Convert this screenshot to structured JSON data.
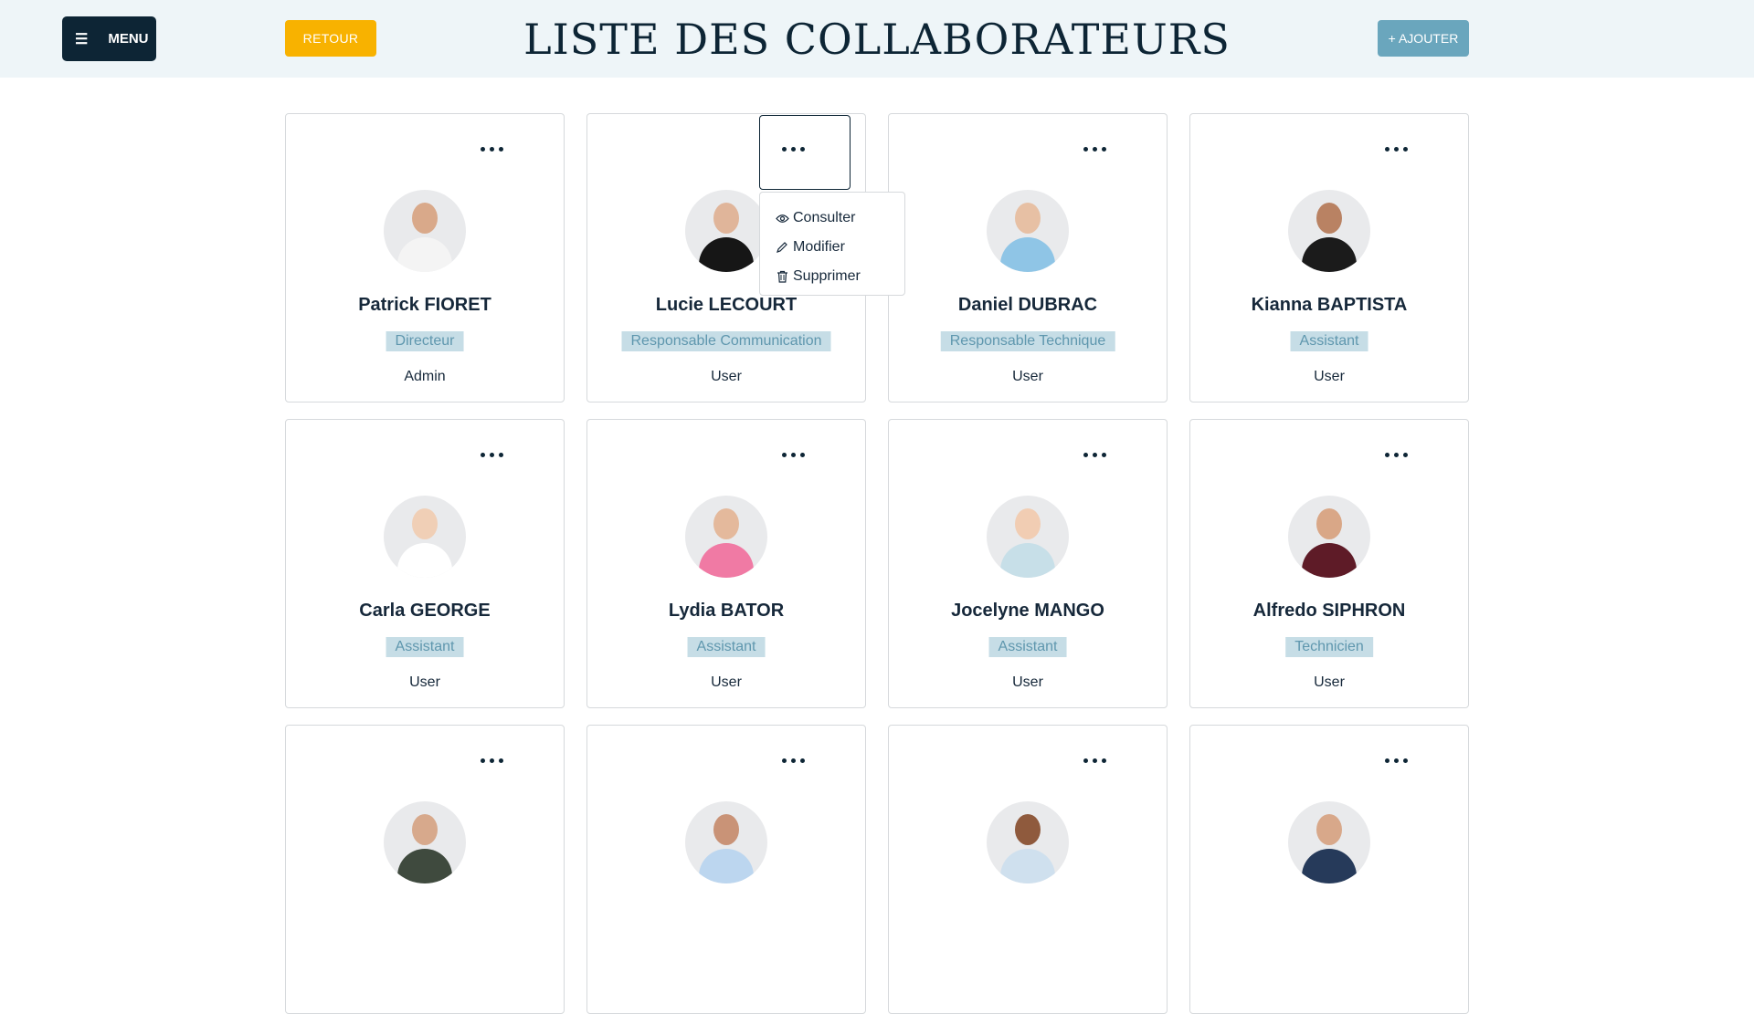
{
  "header": {
    "menu_label": "MENU",
    "back_label": "RETOUR",
    "title": "LISTE DES COLLABORATEURS",
    "add_label": "+ AJOUTER"
  },
  "colors": {
    "header_bg": "#eef5f8",
    "menu_bg": "#0d2535",
    "back_bg": "#f8b200",
    "add_bg": "#6aa6bd",
    "role_bg": "#c6dde6",
    "role_text": "#5f97ae"
  },
  "dropdown": {
    "items": [
      {
        "label": "Consulter",
        "icon": "eye-icon"
      },
      {
        "label": "Modifier",
        "icon": "pencil-icon"
      },
      {
        "label": "Supprimer",
        "icon": "trash-icon"
      }
    ]
  },
  "collaborators": [
    {
      "name": "Patrick FIORET",
      "role": "Directeur",
      "account": "Admin",
      "skin": "#d9a98a",
      "shirt": "#f4f4f4"
    },
    {
      "name": "Lucie LECOURT",
      "role": "Responsable Communication",
      "account": "User",
      "skin": "#e0b59a",
      "shirt": "#161616"
    },
    {
      "name": "Daniel DUBRAC",
      "role": "Responsable Technique",
      "account": "User",
      "skin": "#e7c0a4",
      "shirt": "#8fc5e6"
    },
    {
      "name": "Kianna BAPTISTA",
      "role": "Assistant",
      "account": "User",
      "skin": "#b98263",
      "shirt": "#1b1b1b"
    },
    {
      "name": "Carla GEORGE",
      "role": "Assistant",
      "account": "User",
      "skin": "#f0cfb6",
      "shirt": "#ffffff"
    },
    {
      "name": "Lydia BATOR",
      "role": "Assistant",
      "account": "User",
      "skin": "#e4b99c",
      "shirt": "#f07aa4"
    },
    {
      "name": "Jocelyne MANGO",
      "role": "Assistant",
      "account": "User",
      "skin": "#f1cdb3",
      "shirt": "#c7dfe8"
    },
    {
      "name": "Alfredo SIPHRON",
      "role": "Technicien",
      "account": "User",
      "skin": "#d9a787",
      "shirt": "#5e1b27"
    },
    {
      "name": "",
      "role": "",
      "account": "",
      "skin": "#d7a98c",
      "shirt": "#3f4a3e"
    },
    {
      "name": "",
      "role": "",
      "account": "",
      "skin": "#c99377",
      "shirt": "#bcd6ef"
    },
    {
      "name": "",
      "role": "",
      "account": "",
      "skin": "#8f5a3d",
      "shirt": "#cfe0ee"
    },
    {
      "name": "",
      "role": "",
      "account": "",
      "skin": "#d8a88a",
      "shirt": "#263a5a"
    }
  ]
}
